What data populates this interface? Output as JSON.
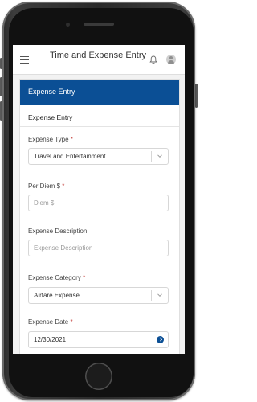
{
  "app": {
    "title": "Time and Expense Entry"
  },
  "card": {
    "header_title": "Expense Entry",
    "section_title": "Expense Entry"
  },
  "fields": {
    "expense_type": {
      "label": "Expense Type",
      "required_mark": "*",
      "value": "Travel and Entertainment"
    },
    "per_diem": {
      "label": "Per Diem $",
      "required_mark": "*",
      "placeholder": "Diem $"
    },
    "expense_description": {
      "label": "Expense Description",
      "placeholder": "Expense Description"
    },
    "expense_category": {
      "label": "Expense Category",
      "required_mark": "*",
      "value": "Airfare Expense"
    },
    "expense_date": {
      "label": "Expense Date",
      "required_mark": "*",
      "value": "12/30/2021"
    }
  },
  "colors": {
    "header_blue": "#0b4f95",
    "required_red": "#c23934"
  },
  "icons": [
    "menu-icon",
    "bell-icon",
    "user-avatar-icon",
    "chevron-down-icon",
    "calendar-icon"
  ]
}
